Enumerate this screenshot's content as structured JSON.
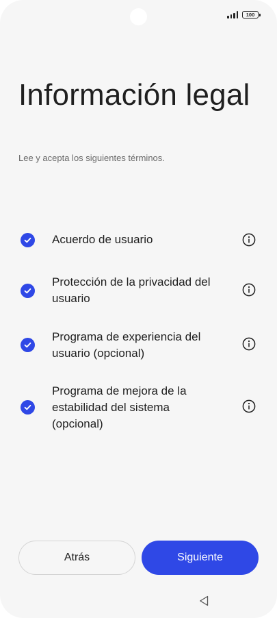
{
  "status_bar": {
    "battery_level": "100",
    "icons": [
      "signal-icon",
      "battery-icon"
    ]
  },
  "header": {
    "title": "Información legal",
    "subtitle": "Lee y acepta los siguientes términos."
  },
  "terms": {
    "items": [
      {
        "label": "Acuerdo de usuario",
        "checked": true
      },
      {
        "label": "Protección de la privacidad del usuario",
        "checked": true
      },
      {
        "label": "Programa de experiencia del usuario (opcional)",
        "checked": true
      },
      {
        "label": "Programa de mejora de la estabilidad del sistema (opcional)",
        "checked": true
      }
    ],
    "check_icon": "check-circle-icon",
    "info_icon": "info-icon"
  },
  "footer": {
    "back_label": "Atrás",
    "next_label": "Siguiente"
  },
  "colors": {
    "accent": "#2f48e6",
    "background": "#f6f6f6",
    "text": "#1f1f1f",
    "subtext": "#6a6a6a"
  },
  "nav_bar": {
    "icons": [
      "back-triangle-icon"
    ]
  }
}
